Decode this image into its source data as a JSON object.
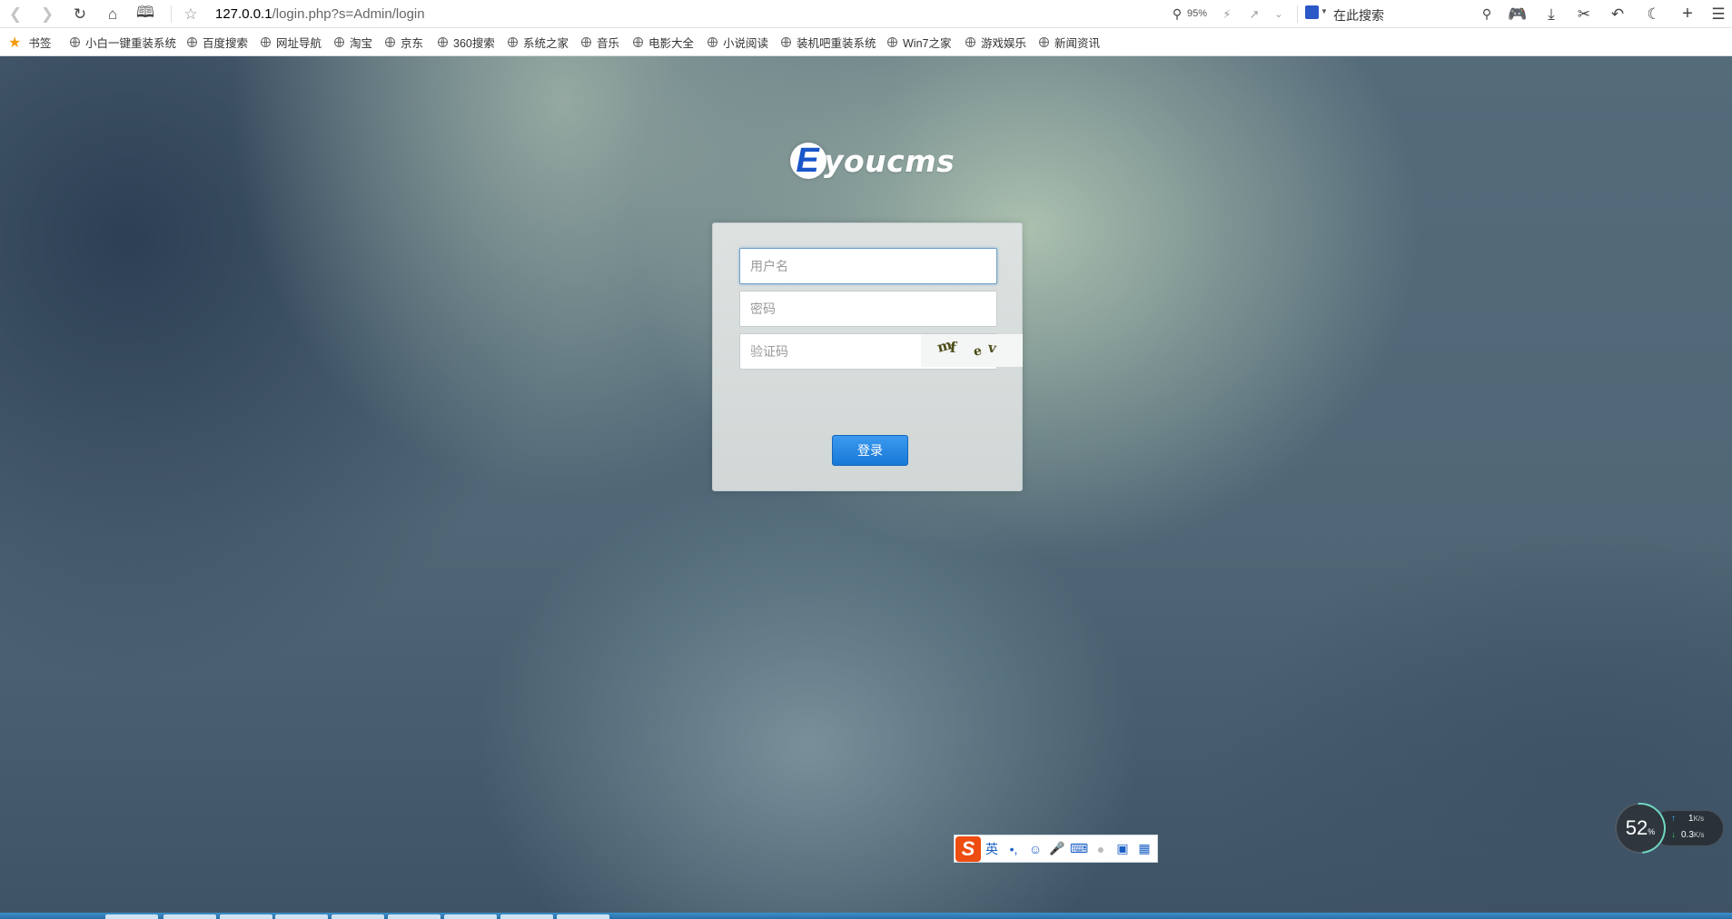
{
  "browser": {
    "url_host": "127.0.0.1",
    "url_path": "/login.php?s=Admin/login",
    "zoom": "95%",
    "search_placeholder": "在此搜索",
    "colors": {
      "toolbar_bg": "#ffffff",
      "accent_orange": "#f39c12"
    }
  },
  "bookmarks": {
    "star_label": "书签",
    "items": [
      "小白一键重装系统",
      "百度搜索",
      "网址导航",
      "淘宝",
      "京东",
      "360搜索",
      "系统之家",
      "音乐",
      "电影大全",
      "小说阅读",
      "装机吧重装系统",
      "Win7之家",
      "游戏娱乐",
      "新闻资讯"
    ]
  },
  "login": {
    "logo_letter": "E",
    "logo_text": "youcms",
    "username_placeholder": "用户名",
    "password_placeholder": "密码",
    "captcha_placeholder": "验证码",
    "captcha_chars": [
      "m",
      "f",
      "e",
      "v"
    ],
    "submit_label": "登录",
    "colors": {
      "button": "#1e80dd",
      "logo_blue": "#1a56c9"
    }
  },
  "ime": {
    "logo": "S",
    "mode": "英",
    "punct": "•,",
    "icons": [
      "smile-icon",
      "microphone-icon",
      "keyboard-icon",
      "user-icon",
      "shirt-icon",
      "grid-icon"
    ]
  },
  "speed_widget": {
    "percent": "52",
    "percent_unit": "%",
    "upload": "1",
    "download": "0.3",
    "unit": "K/s"
  }
}
